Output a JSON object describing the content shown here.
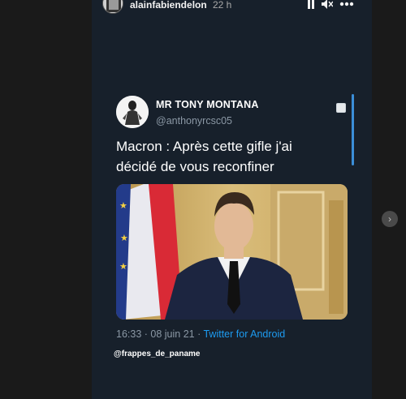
{
  "header": {
    "username": "alainfabiendelon",
    "time": "22 h",
    "pause_icon": "pause-icon",
    "mute_icon": "mute-icon",
    "more_icon": "more-icon"
  },
  "tweet": {
    "display_name": "MR TONY MONTANA",
    "handle": "@anthonyrcsc05",
    "text": "Macron : Après cette gifle j'ai décidé de vous reconfiner",
    "meta_time": "16:33 · 08 juin 21 · ",
    "meta_source": "Twitter for Android",
    "copy_icon": "copy-icon"
  },
  "credit": "@frappes_de_paname",
  "navigation": {
    "next_icon": "chevron-right-icon"
  },
  "colors": {
    "story_bg": "#17202b",
    "link": "#1d9bf0",
    "secondary_text": "#8b98a5"
  }
}
